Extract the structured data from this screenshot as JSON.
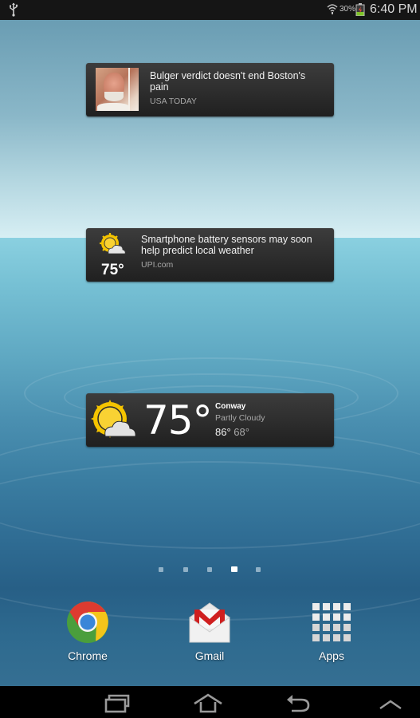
{
  "status_bar": {
    "left_icons": [
      "usb-icon"
    ],
    "right_icons": [
      "wifi-icon",
      "battery-icon"
    ],
    "battery_percent": "30%",
    "time": "6:40 PM"
  },
  "widgets": {
    "news_1": {
      "title": "Bulger verdict doesn't end Boston's pain",
      "source": "USA TODAY",
      "thumbnail": "news-photo"
    },
    "news_2": {
      "title": "Smartphone battery sensors may soon help predict local weather",
      "source": "UPI.com",
      "icon": "partly-cloudy-icon",
      "temperature": "75°"
    },
    "weather": {
      "icon": "partly-cloudy-icon",
      "temperature": "75°",
      "city": "Conway",
      "condition": "Partly Cloudy",
      "high": "86°",
      "low": "68°"
    }
  },
  "home_pages": {
    "count": 5,
    "active_index": 3
  },
  "dock": [
    {
      "label": "Chrome",
      "icon": "chrome-icon"
    },
    {
      "label": "Gmail",
      "icon": "gmail-icon"
    },
    {
      "label": "Apps",
      "icon": "apps-grid-icon"
    }
  ],
  "nav_bar": {
    "buttons": [
      "recent-apps",
      "home",
      "back",
      "menu-up"
    ]
  },
  "colors": {
    "widget_bg": "#2a2a2a",
    "sun_yellow": "#f5c400",
    "active_dot": "#ffffff",
    "inactive_dot": "#8fb0c6"
  }
}
